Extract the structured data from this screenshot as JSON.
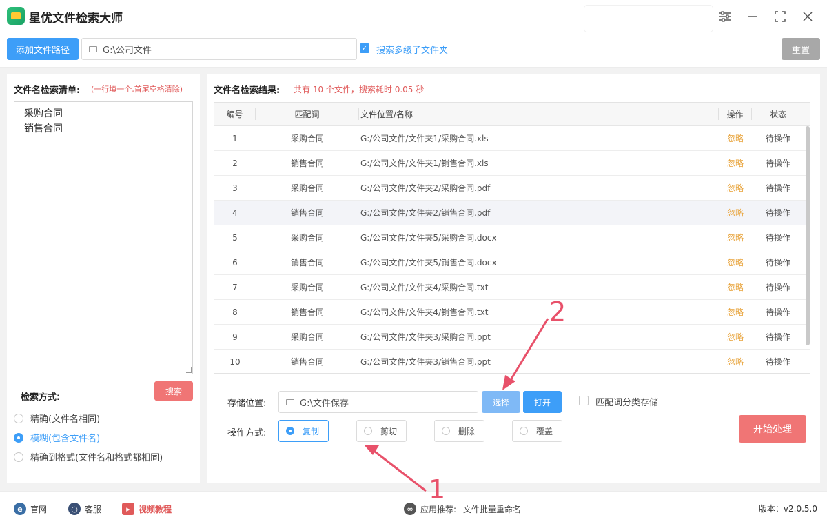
{
  "app": {
    "title": "星优文件检索大师"
  },
  "window_controls": [
    "settings-icon",
    "minimize-icon",
    "maximize-icon",
    "close-icon"
  ],
  "toolbar": {
    "add_path_label": "添加文件路径",
    "path_value": "G:\\公司文件",
    "include_subfolders_label": "搜索多级子文件夹",
    "include_subfolders_checked": true,
    "reset_label": "重置"
  },
  "left": {
    "title": "文件名检索清单:",
    "hint": "(一行填一个,首尾空格清除)",
    "keywords": [
      "采购合同",
      "销售合同"
    ],
    "search_label": "搜索",
    "mode_title": "检索方式:",
    "modes": [
      {
        "label": "精确(文件名相同)",
        "selected": false
      },
      {
        "label": "模糊(包含文件名)",
        "selected": true
      },
      {
        "label": "精确到格式(文件名和格式都相同)",
        "selected": false
      }
    ]
  },
  "results": {
    "title": "文件名检索结果:",
    "summary": "共有 10 个文件，搜索耗时 0.05 秒",
    "columns": [
      "编号",
      "匹配词",
      "文件位置/名称",
      "操作",
      "状态"
    ],
    "rows": [
      {
        "no": "1",
        "match": "采购合同",
        "path": "G:/公司文件/文件夹1/采购合同.xls",
        "action": "忽略",
        "status": "待操作"
      },
      {
        "no": "2",
        "match": "销售合同",
        "path": "G:/公司文件/文件夹1/销售合同.xls",
        "action": "忽略",
        "status": "待操作"
      },
      {
        "no": "3",
        "match": "采购合同",
        "path": "G:/公司文件/文件夹2/采购合同.pdf",
        "action": "忽略",
        "status": "待操作"
      },
      {
        "no": "4",
        "match": "销售合同",
        "path": "G:/公司文件/文件夹2/销售合同.pdf",
        "action": "忽略",
        "status": "待操作"
      },
      {
        "no": "5",
        "match": "采购合同",
        "path": "G:/公司文件/文件夹5/采购合同.docx",
        "action": "忽略",
        "status": "待操作"
      },
      {
        "no": "6",
        "match": "销售合同",
        "path": "G:/公司文件/文件夹5/销售合同.docx",
        "action": "忽略",
        "status": "待操作"
      },
      {
        "no": "7",
        "match": "采购合同",
        "path": "G:/公司文件/文件夹4/采购合同.txt",
        "action": "忽略",
        "status": "待操作"
      },
      {
        "no": "8",
        "match": "销售合同",
        "path": "G:/公司文件/文件夹4/销售合同.txt",
        "action": "忽略",
        "status": "待操作"
      },
      {
        "no": "9",
        "match": "采购合同",
        "path": "G:/公司文件/文件夹3/采购合同.ppt",
        "action": "忽略",
        "status": "待操作"
      },
      {
        "no": "10",
        "match": "销售合同",
        "path": "G:/公司文件/文件夹3/销售合同.ppt",
        "action": "忽略",
        "status": "待操作"
      }
    ]
  },
  "storage": {
    "label": "存储位置:",
    "path": "G:\\文件保存",
    "choose_label": "选择",
    "open_label": "打开",
    "classify_label": "匹配词分类存储",
    "classify_checked": false
  },
  "operation": {
    "label": "操作方式:",
    "options": [
      {
        "label": "复制",
        "selected": true
      },
      {
        "label": "剪切",
        "selected": false
      },
      {
        "label": "删除",
        "selected": false
      },
      {
        "label": "覆盖",
        "selected": false
      }
    ],
    "start_label": "开始处理"
  },
  "footer": {
    "website": "官网",
    "support": "客服",
    "video": "视频教程",
    "recommend_prefix": "应用推荐:",
    "recommend_app": "文件批量重命名",
    "version": "版本：v2.0.5.0"
  },
  "annotations": {
    "num1": "1",
    "num2": "2"
  },
  "colors": {
    "primary": "#3d9ef8",
    "danger": "#f07575",
    "action": "#e8a33a",
    "annotation": "#e8516a"
  }
}
